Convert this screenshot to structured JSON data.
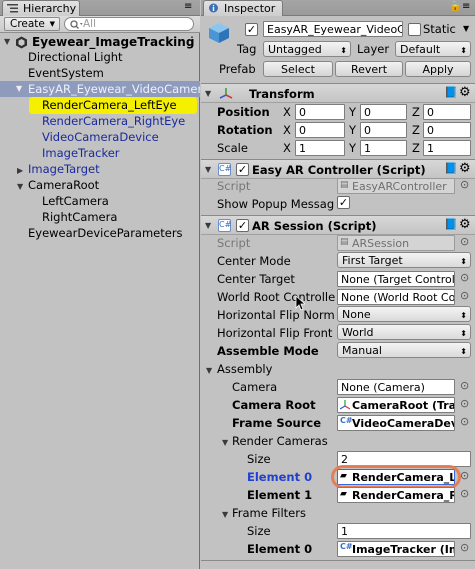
{
  "hierarchy": {
    "tab": "Hierarchy",
    "create": "Create",
    "search_placeholder": "All",
    "scene": "Eyewear_ImageTracking",
    "items": [
      {
        "label": "Directional Light"
      },
      {
        "label": "EventSystem"
      },
      {
        "label": "EasyAR_Eyewear_VideoCameraDevice"
      },
      {
        "label": "RenderCamera_LeftEye"
      },
      {
        "label": "RenderCamera_RightEye"
      },
      {
        "label": "VideoCameraDevice"
      },
      {
        "label": "ImageTracker"
      },
      {
        "label": "ImageTarget"
      },
      {
        "label": "CameraRoot"
      },
      {
        "label": "LeftCamera"
      },
      {
        "label": "RightCamera"
      },
      {
        "label": "EyewearDeviceParameters"
      }
    ]
  },
  "inspector": {
    "tab": "Inspector",
    "object_name": "EasyAR_Eyewear_VideoCameraDevice",
    "static_label": "Static",
    "tag_label": "Tag",
    "tag_value": "Untagged",
    "layer_label": "Layer",
    "layer_value": "Default",
    "prefab_label": "Prefab",
    "select": "Select",
    "revert": "Revert",
    "apply": "Apply",
    "transform": {
      "title": "Transform",
      "position": "Position",
      "rotation": "Rotation",
      "scale": "Scale",
      "x": "X",
      "y": "Y",
      "z": "Z",
      "pos": [
        "0",
        "0",
        "0"
      ],
      "rot": [
        "0",
        "0",
        "0"
      ],
      "scl": [
        "1",
        "1",
        "1"
      ]
    },
    "easyar_controller": {
      "title": "Easy AR Controller (Script)",
      "script_label": "Script",
      "script_value": "EasyARController",
      "popup_label": "Show Popup Messag"
    },
    "ar_session": {
      "title": "AR Session (Script)",
      "script_label": "Script",
      "script_value": "ARSession",
      "center_mode_label": "Center Mode",
      "center_mode_value": "First Target",
      "center_target_label": "Center Target",
      "center_target_value": "None (Target Controller)",
      "world_root_label": "World Root Controller",
      "world_root_value": "None (World Root Controller)",
      "hflip_normal_label": "Horizontal Flip Normal",
      "hflip_normal_value": "None",
      "hflip_front_label": "Horizontal Flip Front",
      "hflip_front_value": "World",
      "assemble_label": "Assemble Mode",
      "assemble_value": "Manual",
      "assembly_label": "Assembly",
      "camera_label": "Camera",
      "camera_value": "None (Camera)",
      "camera_root_label": "Camera Root",
      "camera_root_value": "CameraRoot (Transform)",
      "frame_source_label": "Frame Source",
      "frame_source_value": "VideoCameraDevice",
      "render_cameras_label": "Render Cameras",
      "size_label": "Size",
      "rc_size": "2",
      "element0_label": "Element 0",
      "element0_value": "RenderCamera_LeftEye",
      "element1_label": "Element 1",
      "element1_value": "RenderCamera_RightEye",
      "frame_filters_label": "Frame Filters",
      "ff_size": "1",
      "ff_element0_label": "Element 0",
      "ff_element0_value": "ImageTracker (ImageTrackerFrameFilter)"
    }
  },
  "colors": {
    "panel_bg": "#c2c2c2",
    "selection_blue": "#8e9bbd",
    "highlight_yellow": "#f5ef00",
    "annotation_orange": "#e8784a",
    "prefab_blue": "#1a2a9c"
  }
}
